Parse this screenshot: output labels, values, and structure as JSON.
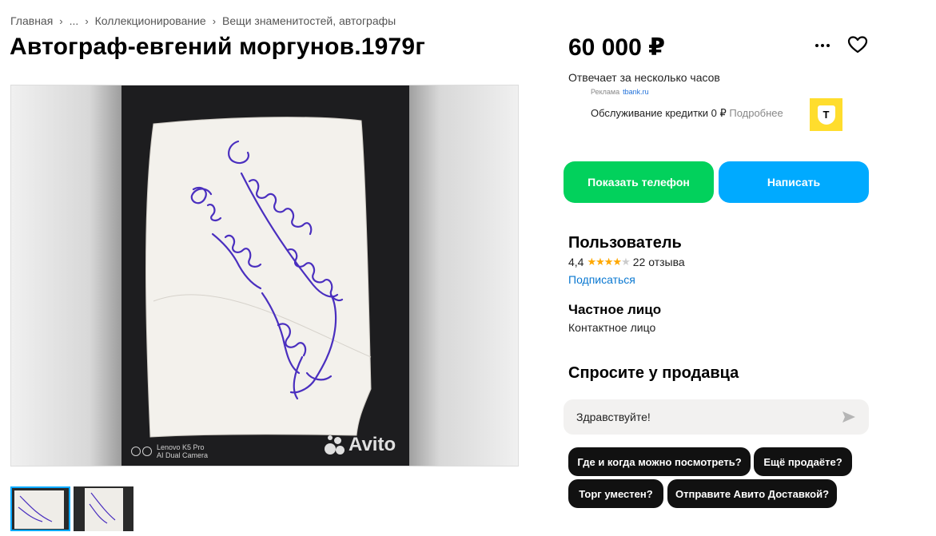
{
  "breadcrumb": {
    "items": [
      "Главная",
      "...",
      "Коллекционирование",
      "Вещи знаменитостей, автографы"
    ]
  },
  "listing": {
    "title": "Автограф-евгений моргунов.1979г",
    "price": "60 000 ₽"
  },
  "gallery": {
    "camera_line1": "Lenovo K5 Pro",
    "camera_line2": "AI Dual Camera",
    "watermark": "Avito",
    "autograph_text": "С уважением Е. Моргунов"
  },
  "seller_panel": {
    "responds": "Отвечает за несколько часов",
    "ad_label": "Реклама",
    "ad_domain": "tbank.ru",
    "ad_text": "Обслуживание кредитки 0 ₽",
    "ad_more": "Подробнее",
    "ad_logo_letter": "Т",
    "show_phone": "Показать телефон",
    "write": "Написать"
  },
  "seller": {
    "name": "Пользователь",
    "rating": "4,4",
    "rating_value": 4.4,
    "reviews": "22 отзыва",
    "subscribe": "Подписаться",
    "type": "Частное лицо",
    "contact": "Контактное лицо"
  },
  "ask": {
    "title": "Спросите у продавца",
    "message_value": "Здравствуйте!",
    "chips": [
      "Где и когда можно посмотреть?",
      "Ещё продаёте?",
      "Торг уместен?",
      "Отправите Авито Доставкой?"
    ]
  },
  "colors": {
    "green": "#02d15c",
    "blue": "#00aaff",
    "star": "#ffa800",
    "tbank_yellow": "#ffdd2d"
  }
}
